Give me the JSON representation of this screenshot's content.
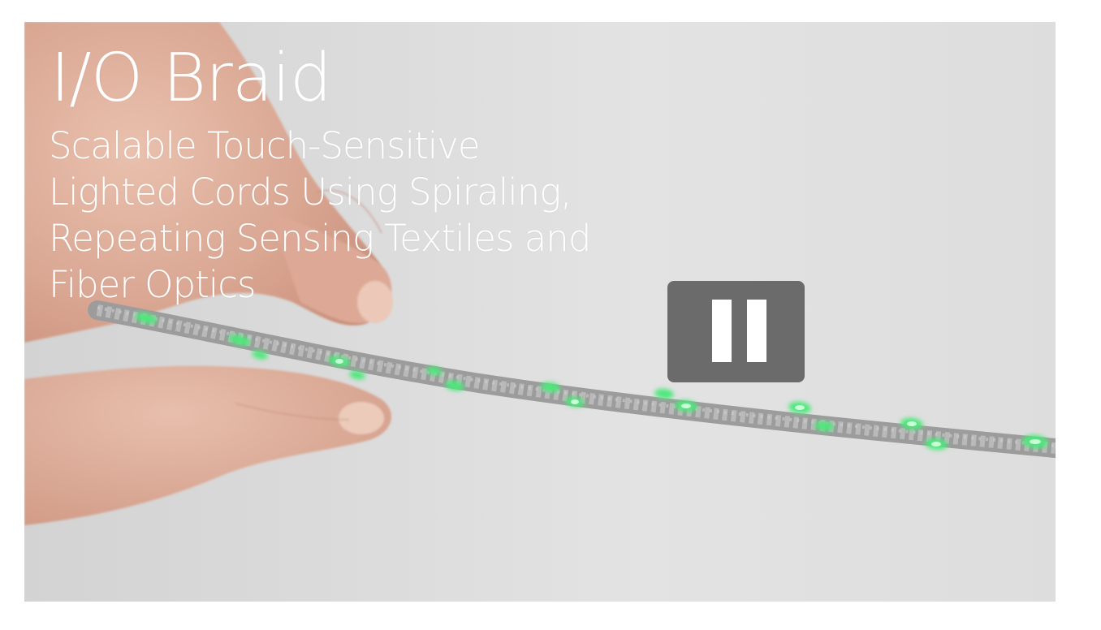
{
  "video": {
    "title": "I/O Braid",
    "subtitle": "Scalable Touch-Sensitive Lighted Cords Using Spiraling, Repeating Sensing Textiles and Fiber Optics",
    "state": "playing",
    "control_icon": "pause-icon"
  },
  "colors": {
    "background": "#dcdcdc",
    "cord": "#a9a9a9",
    "fiber_glow": "#4de87a",
    "control_bg": "#6b6b6b"
  }
}
